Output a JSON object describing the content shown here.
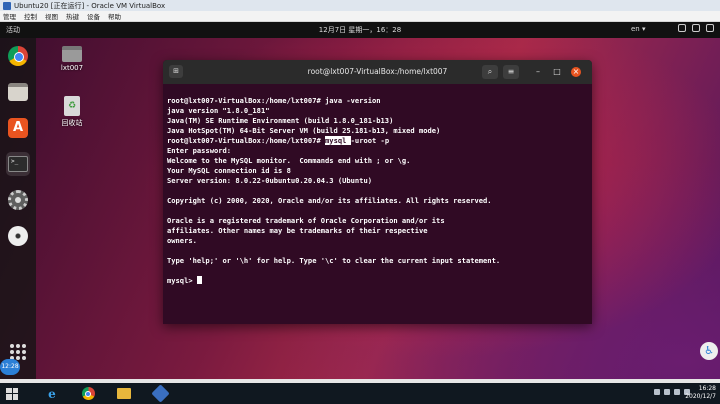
{
  "host": {
    "title": "Ubuntu20 [正在运行] - Oracle VM VirtualBox",
    "menu": [
      "管理",
      "控制",
      "视图",
      "热键",
      "设备",
      "帮助"
    ]
  },
  "topbar": {
    "activities": "活动",
    "clock": "12月7日 星期一，16：28",
    "input_method": "en ▾"
  },
  "desktop": {
    "home_label": "lxt007",
    "trash_label": "回收站"
  },
  "terminal": {
    "title": "root@lxt007-VirtualBox:/home/lxt007",
    "lines": [
      "root@lxt007-VirtualBox:/home/lxt007# java -version",
      "java version \"1.8.0_181\"",
      "Java(TM) SE Runtime Environment (build 1.8.0_181-b13)",
      "Java HotSpot(TM) 64-Bit Server VM (build 25.181-b13, mixed mode)",
      "",
      "Enter password:",
      "Welcome to the MySQL monitor.  Commands end with ; or \\g.",
      "Your MySQL connection id is 8",
      "Server version: 8.0.22-0ubuntu0.20.04.3 (Ubuntu)",
      "",
      "Copyright (c) 2000, 2020, Oracle and/or its affiliates. All rights reserved.",
      "",
      "Oracle is a registered trademark of Oracle Corporation and/or its",
      "affiliates. Other names may be trademarks of their respective",
      "owners.",
      "",
      "Type 'help;' or '\\h' for help. Type '\\c' to clear the current input statement.",
      ""
    ],
    "mysql_cmd_prompt": "root@lxt007-VirtualBox:/home/lxt007# ",
    "mysql_cmd_selected": "mysql ",
    "mysql_cmd_rest": "-uroot -p",
    "mysql_prompt": "mysql> "
  },
  "guest_badge": "12:28",
  "taskbar": {
    "time": "16:28",
    "date": "2020/12/7"
  },
  "colors": {
    "terminal_bg": "#300a24",
    "ubuntu_orange": "#e95420",
    "topbar_bg": "#111111"
  },
  "icons": {
    "dock": [
      "chrome-icon",
      "files-icon",
      "software-center-icon",
      "terminal-icon",
      "settings-icon",
      "disc-icon",
      "show-apps-icon"
    ],
    "terminal_header": [
      "new-tab-icon",
      "search-icon",
      "hamburger-menu-icon",
      "minimize-icon",
      "maximize-icon",
      "close-icon"
    ]
  }
}
